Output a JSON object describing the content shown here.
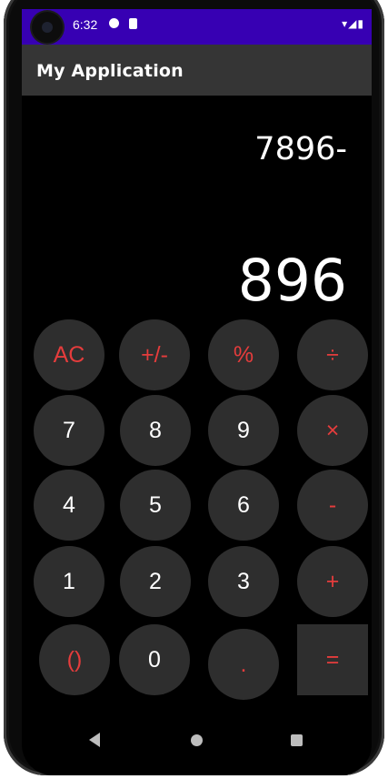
{
  "status_bar": {
    "time": "6:32",
    "icons": [
      "camera-icon",
      "data-saver-icon",
      "sd-card-icon",
      "wifi-icon",
      "signal-icon",
      "battery-icon"
    ]
  },
  "app_bar": {
    "title": "My Application"
  },
  "display": {
    "expression": "7896-",
    "result": "896"
  },
  "colors": {
    "status_bar": "#3700b3",
    "app_bar": "#353535",
    "key_bg": "#2e2e2e",
    "operator": "#e53c3c",
    "digit": "#ffffff"
  },
  "keys": {
    "ac": "AC",
    "sign": "+/-",
    "percent": "%",
    "divide": "÷",
    "seven": "7",
    "eight": "8",
    "nine": "9",
    "multiply": "×",
    "four": "4",
    "five": "5",
    "six": "6",
    "minus": "-",
    "one": "1",
    "two": "2",
    "three": "3",
    "plus": "+",
    "parens": "()",
    "zero": "0",
    "dot": ".",
    "equals": "="
  },
  "nav": [
    "back-icon",
    "home-icon",
    "recents-icon"
  ]
}
